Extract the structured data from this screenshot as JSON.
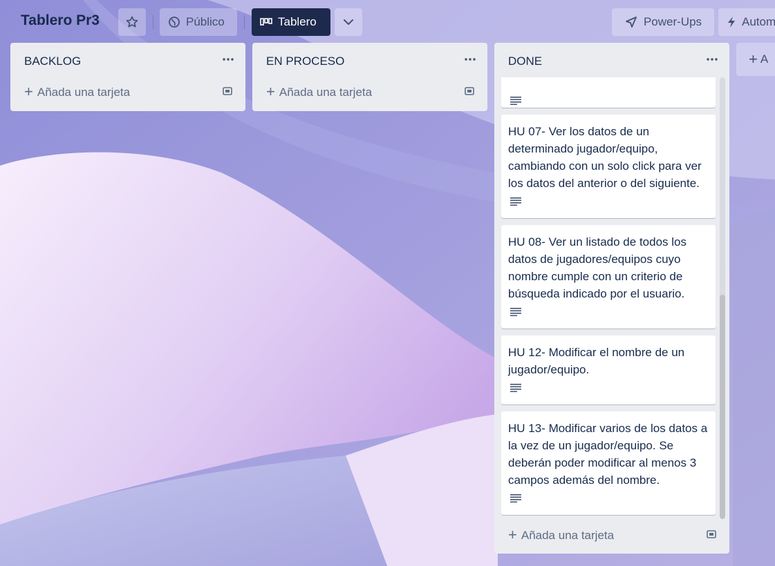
{
  "board": {
    "title": "Tablero Pr3",
    "visibility_label": "Público",
    "view_label": "Tablero",
    "powerups_label": "Power-Ups",
    "automation_label": "Autom",
    "add_list_label": "A"
  },
  "lists": [
    {
      "title": "BACKLOG",
      "add_card_label": "Añada una tarjeta"
    },
    {
      "title": "EN PROCESO",
      "add_card_label": "Añada una tarjeta"
    },
    {
      "title": "DONE",
      "add_card_label": "Añada una tarjeta",
      "cards": [
        {
          "text": ""
        },
        {
          "text": "HU 07- Ver los datos de un determinado jugador/equipo, cambiando con un solo click para ver los datos del anterior o del siguiente."
        },
        {
          "text": "HU 08- Ver un listado de todos los datos de jugadores/equipos cuyo nombre cumple con un criterio de búsqueda indicado por el usuario."
        },
        {
          "text": "HU 12- Modificar el nombre de un jugador/equipo."
        },
        {
          "text": "HU 13- Modificar varios de los datos a la vez de un jugador/equipo. Se deberán poder modificar al menos 3 campos además del nombre."
        }
      ]
    }
  ],
  "colors": {
    "list_bg": "#ebecf0",
    "text_primary": "#172b4d",
    "text_secondary": "#5e6c84",
    "view_button_bg": "#1d2a4d"
  },
  "icons": {
    "star": "star-icon",
    "visibility": "globe-icon",
    "board_view": "board-icon",
    "views_dropdown": "chevron-down-icon",
    "powerups": "rocket-icon",
    "automation": "lightning-icon",
    "list_menu": "more-icon",
    "card_template": "template-icon",
    "description": "description-icon"
  }
}
